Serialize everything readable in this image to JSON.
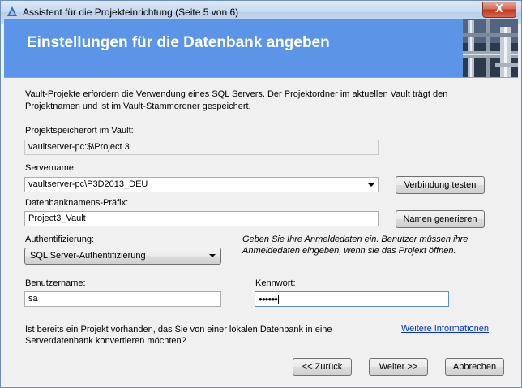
{
  "window": {
    "title": "Assistent für die Projekteinrichtung (Seite 5 von 6)",
    "close_glyph": "X",
    "app_icon": "autodesk-vault-icon"
  },
  "banner": {
    "title": "Einstellungen für die Datenbank angeben",
    "color": "#5c95e7"
  },
  "intro_text": "Vault-Projekte erfordern die Verwendung eines SQL Servers. Der Projektordner im aktuellen Vault trägt den Projektnamen und ist im Vault-Stammordner gespeichert.",
  "project_location": {
    "label": "Projektspeicherort im Vault:",
    "value": "vaultserver-pc:$\\Project 3"
  },
  "server": {
    "label": "Servername:",
    "value": "vaultserver-pc\\P3D2013_DEU",
    "test_button": "Verbindung testen"
  },
  "db_prefix": {
    "label": "Datenbanknamens-Präfix:",
    "value": "Project3_Vault",
    "generate_button": "Namen generieren"
  },
  "auth": {
    "label": "Authentifizierung:",
    "selected": "SQL Server-Authentifizierung",
    "hint": "Geben Sie Ihre Anmeldedaten ein. Benutzer müssen ihre Anmeldedaten eingeben, wenn sie das Projekt öffnen."
  },
  "username": {
    "label": "Benutzername:",
    "value": "sa"
  },
  "password": {
    "label": "Kennwort:",
    "masked": "●●●●●●"
  },
  "convert": {
    "question": "Ist bereits ein Projekt vorhanden, das Sie von einer lokalen Datenbank in eine Serverdatenbank konvertieren möchten?",
    "link": "Weitere Informationen"
  },
  "footer": {
    "back": "<< Zurück",
    "next": "Weiter >>",
    "cancel": "Abbrechen"
  }
}
